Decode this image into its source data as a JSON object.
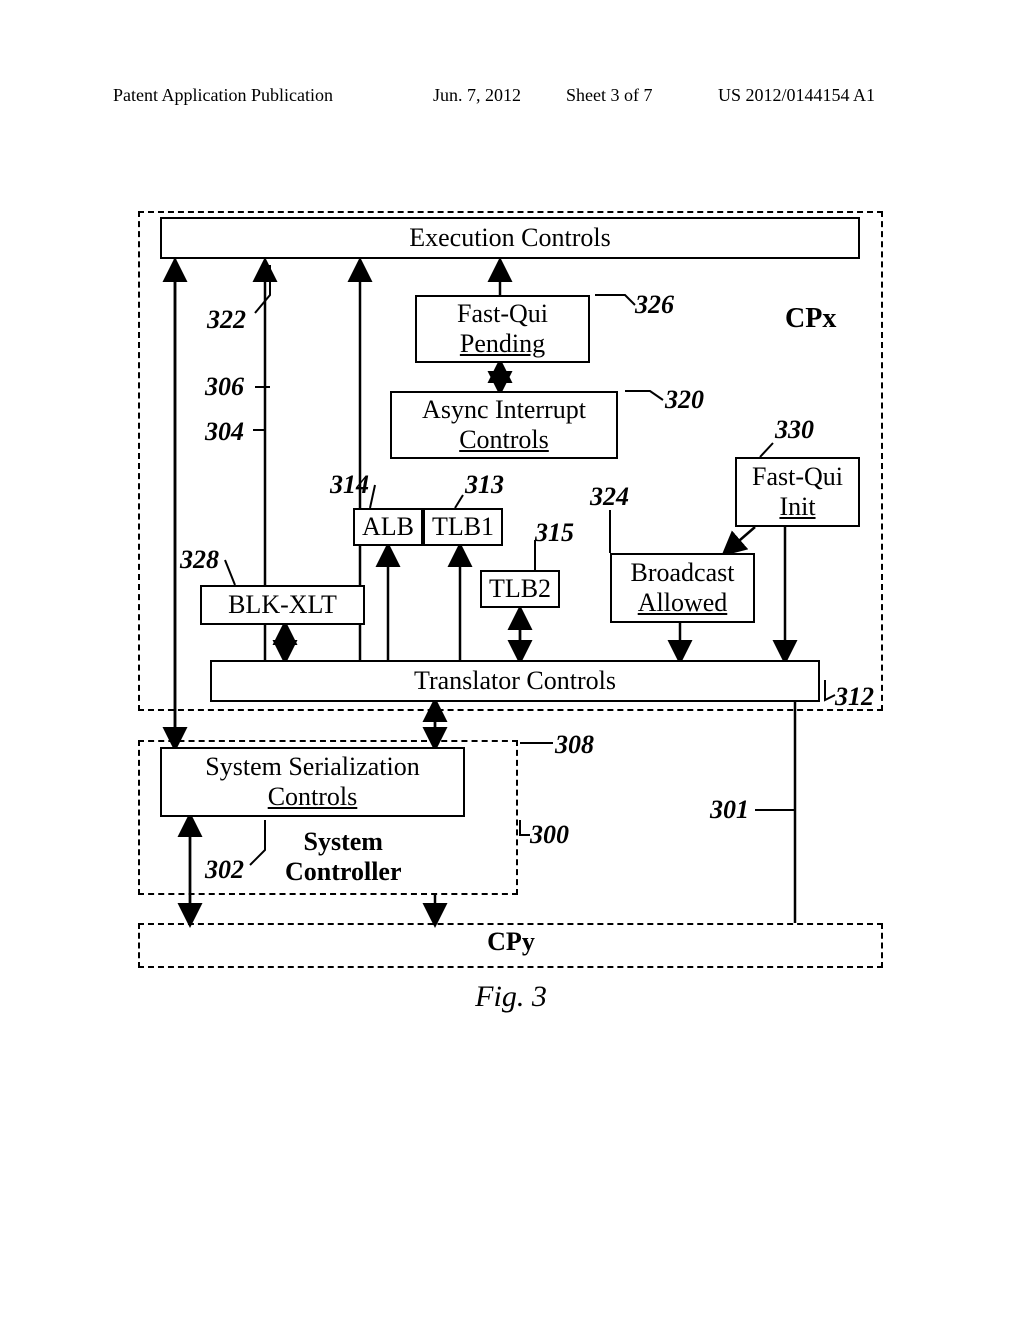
{
  "header": {
    "publication": "Patent Application Publication",
    "date": "Jun. 7, 2012",
    "sheet": "Sheet 3 of 7",
    "docnum": "US 2012/0144154 A1"
  },
  "blocks": {
    "exec_controls": "Execution Controls",
    "fast_qui_pending_l1": "Fast-Qui",
    "fast_qui_pending_l2": "Pending",
    "async_int_l1": "Async Interrupt",
    "async_int_l2": "Controls",
    "alb": "ALB",
    "tlb1": "TLB1",
    "tlb2": "TLB2",
    "fast_qui_init_l1": "Fast-Qui",
    "fast_qui_init_l2": "Init",
    "broadcast_l1": "Broadcast",
    "broadcast_l2": "Allowed",
    "blk_xlt": "BLK-XLT",
    "translator": "Translator Controls",
    "sys_serial_l1": "System Serialization",
    "sys_serial_l2": "Controls",
    "sys_ctrl_l1": "System",
    "sys_ctrl_l2": "Controller",
    "cpx": "CPx",
    "cpy": "CPy"
  },
  "refs": {
    "r300": "300",
    "r301": "301",
    "r302": "302",
    "r304": "304",
    "r306": "306",
    "r308": "308",
    "r312": "312",
    "r313": "313",
    "r314": "314",
    "r315": "315",
    "r320": "320",
    "r322": "322",
    "r324": "324",
    "r326": "326",
    "r328": "328",
    "r330": "330"
  },
  "caption": "Fig. 3"
}
